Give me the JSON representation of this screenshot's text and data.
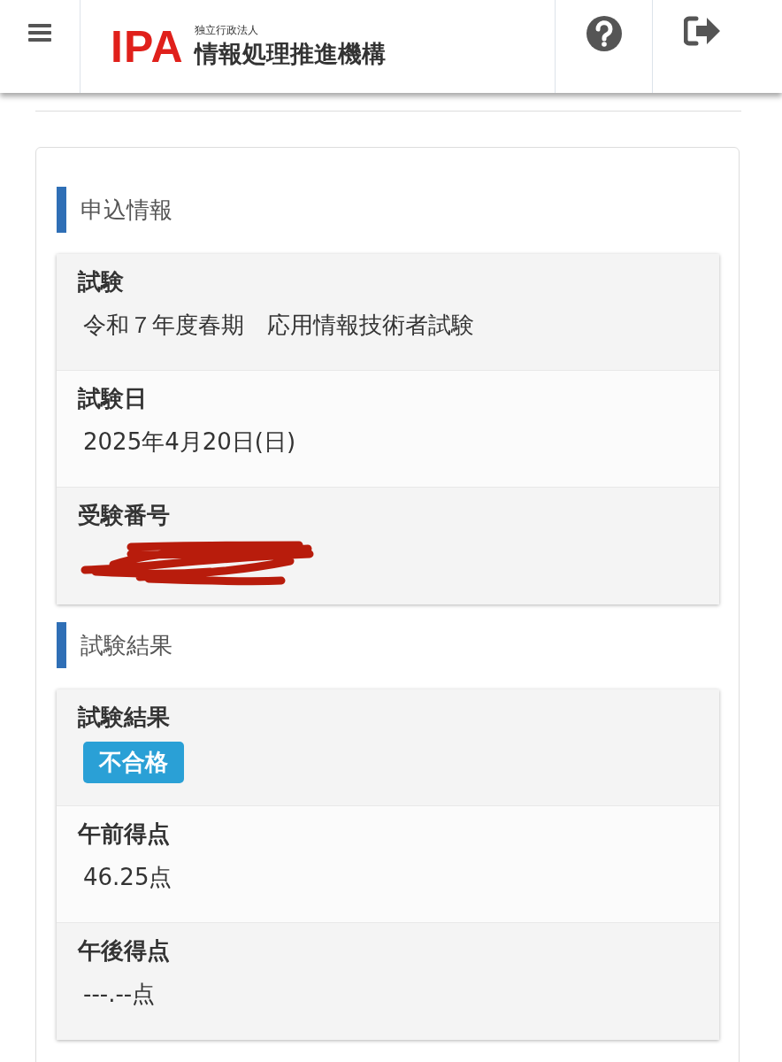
{
  "header": {
    "logo": {
      "mark": "IPA",
      "subtitle": "独立行政法人",
      "name": "情報処理推進機構"
    }
  },
  "sections": [
    {
      "title": "申込情報",
      "rows": [
        {
          "kind": "text",
          "label": "試験",
          "value": "令和７年度春期　応用情報技術者試験"
        },
        {
          "kind": "text",
          "label": "試験日",
          "value": "2025年4月20日(日)"
        },
        {
          "kind": "redacted",
          "label": "受験番号"
        }
      ]
    },
    {
      "title": "試験結果",
      "rows": [
        {
          "kind": "badge",
          "label": "試験結果",
          "value": "不合格"
        },
        {
          "kind": "text",
          "label": "午前得点",
          "value": "46.25点"
        },
        {
          "kind": "text",
          "label": "午後得点",
          "value": "---.--点"
        }
      ]
    }
  ]
}
